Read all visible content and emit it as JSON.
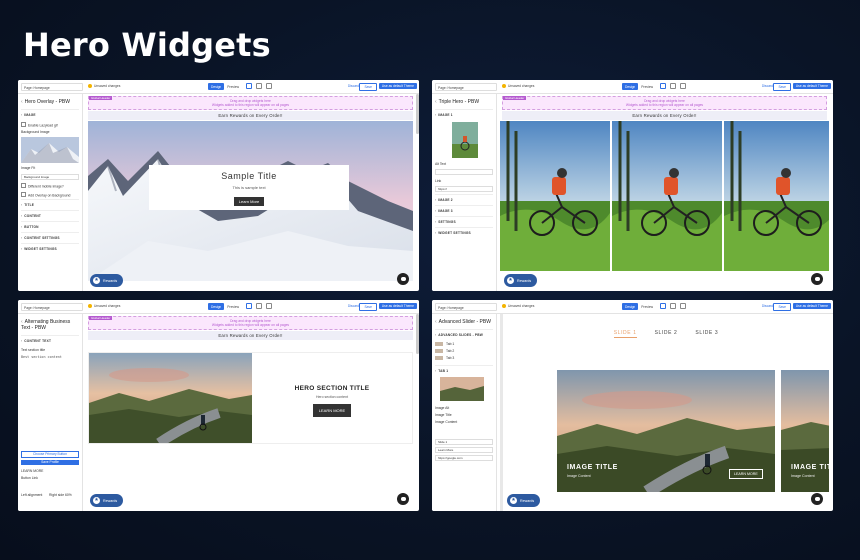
{
  "heading": "Hero Widgets",
  "common": {
    "page_select": "Page: Homepage",
    "unsaved": "Unsaved changes",
    "design": "Design",
    "preview": "Preview",
    "discard": "Discard",
    "save": "Save",
    "use_theme": "Use as default Theme",
    "earn": "Earn Rewards on Every Order!",
    "rewards": "Rewards",
    "announcement_tag": "Global Header",
    "announcement_l1": "Drag and drop widgets here",
    "announcement_l2": "Widgets added to this region will appear on all pages"
  },
  "shot1": {
    "widget_title": "Hero Overlay - PBW",
    "sections": [
      "IMAGE",
      "TITLE",
      "CONTENT",
      "BUTTON",
      "CONTENT SETTINGS",
      "WIDGET SETTINGS"
    ],
    "rows": [
      "Enable Lazyload gif",
      "Background Image",
      "Image Fit",
      "Background Image",
      "Different mobile image?",
      "Add Overlay on Background"
    ],
    "hero_title": "Sample Title",
    "hero_text": "This is sample text",
    "hero_button": "Learn More"
  },
  "shot2": {
    "widget_title": "Triple Hero - PBW",
    "sections": [
      "IMAGE 1",
      "IMAGE 2",
      "IMAGE 3",
      "SETTINGS",
      "WIDGET SETTINGS"
    ],
    "rows": [
      "Alt Text",
      "Link",
      "https://"
    ]
  },
  "shot3": {
    "widget_title": "Alternating Business Text - PBW",
    "sections": [
      "CONTENT TEXT"
    ],
    "rows": [
      "Text section title",
      "Best section content"
    ],
    "hero_title": "HERO SECTION TITLE",
    "hero_text": "Hero section content",
    "hero_button": "LEARN MORE",
    "side_buttons": [
      "Choose Primary Button",
      "Save Profile"
    ],
    "side_label": "LEARN MORE",
    "side_footer": [
      "Button Link",
      "Left alignment",
      "Right side 60%"
    ]
  },
  "shot4": {
    "widget_title": "Advanced Slider - PBW",
    "sections": [
      "ADVANCED SLIDES - PBW",
      "TAB 1"
    ],
    "slides": [
      "Tab 1",
      "Tab 2",
      "Tab 3"
    ],
    "rows": [
      "Image Alt",
      "Image Title",
      "Image Content",
      "Slide 1",
      "Learn More",
      "https://google.com"
    ],
    "tabs": [
      "SLIDE 1",
      "SLIDE 2",
      "SLIDE 3"
    ],
    "image_title": "IMAGE TITLE",
    "image_content": "Image Content",
    "learn_more": "LEARN MORE"
  },
  "colors": {
    "background": "#0a1426",
    "accent": "#2f6fe4",
    "announcement": "#fbe7fd",
    "rewards": "#2d5aa0"
  }
}
